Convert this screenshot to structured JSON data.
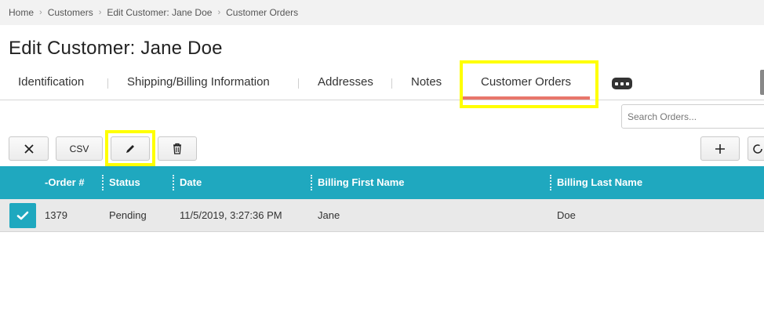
{
  "breadcrumb": {
    "items": [
      "Home",
      "Customers",
      "Edit Customer: Jane Doe",
      "Customer Orders"
    ],
    "separator": "›"
  },
  "page": {
    "title": "Edit Customer: Jane Doe"
  },
  "tabs": {
    "items": [
      {
        "label": "Identification",
        "active": false
      },
      {
        "label": "Shipping/Billing Information",
        "active": false
      },
      {
        "label": "Addresses",
        "active": false
      },
      {
        "label": "Notes",
        "active": false
      },
      {
        "label": "Customer Orders",
        "active": true
      }
    ],
    "more_icon": "ellipsis-icon"
  },
  "search": {
    "placeholder": "Search Orders...",
    "value": ""
  },
  "toolbar": {
    "close_icon": "close-icon",
    "csv_label": "CSV",
    "edit_icon": "pencil-icon",
    "delete_icon": "trash-icon",
    "add_icon": "plus-icon"
  },
  "grid": {
    "columns": [
      "-Order #",
      "Status",
      "Date",
      "Billing First Name",
      "Billing Last Name"
    ],
    "rows": [
      {
        "selected": true,
        "order": "1379",
        "status": "Pending",
        "date": "11/5/2019, 3:27:36 PM",
        "first_name": "Jane",
        "last_name": "Doe"
      }
    ]
  },
  "colors": {
    "accent_teal": "#1fa8bf",
    "active_tab_underline": "#e8766b",
    "highlight_yellow": "#ffff00"
  }
}
